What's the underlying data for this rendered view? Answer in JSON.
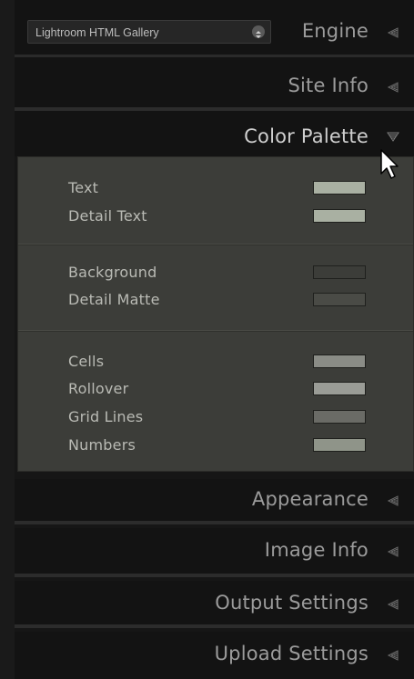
{
  "engine": {
    "select_value": "Lightroom HTML Gallery",
    "title": "Engine"
  },
  "panels": {
    "site_info": "Site Info",
    "color_palette": "Color Palette",
    "appearance": "Appearance",
    "image_info": "Image Info",
    "output_settings": "Output Settings",
    "upload_settings": "Upload Settings"
  },
  "color_palette": {
    "group1": [
      {
        "label": "Text",
        "color": "#a9b0a2"
      },
      {
        "label": "Detail Text",
        "color": "#a9b0a2"
      }
    ],
    "group2": [
      {
        "label": "Background",
        "color": "#3c3d39"
      },
      {
        "label": "Detail Matte",
        "color": "#4a4b46"
      }
    ],
    "group3": [
      {
        "label": "Cells",
        "color": "#8a8c86"
      },
      {
        "label": "Rollover",
        "color": "#9a9c96"
      },
      {
        "label": "Grid Lines",
        "color": "#6a6b66"
      },
      {
        "label": "Numbers",
        "color": "#8f9489"
      }
    ]
  },
  "colors": {
    "panel_bg": "#131313",
    "content_bg": "#3c3d39",
    "header_text": "#9b9b9b",
    "open_header_text": "#cfcfcf"
  },
  "icons": {
    "collapsed": "triangle-left-icon",
    "expanded": "triangle-down-icon",
    "stepper": "up-down-stepper-icon",
    "cursor": "mouse-pointer-icon"
  }
}
